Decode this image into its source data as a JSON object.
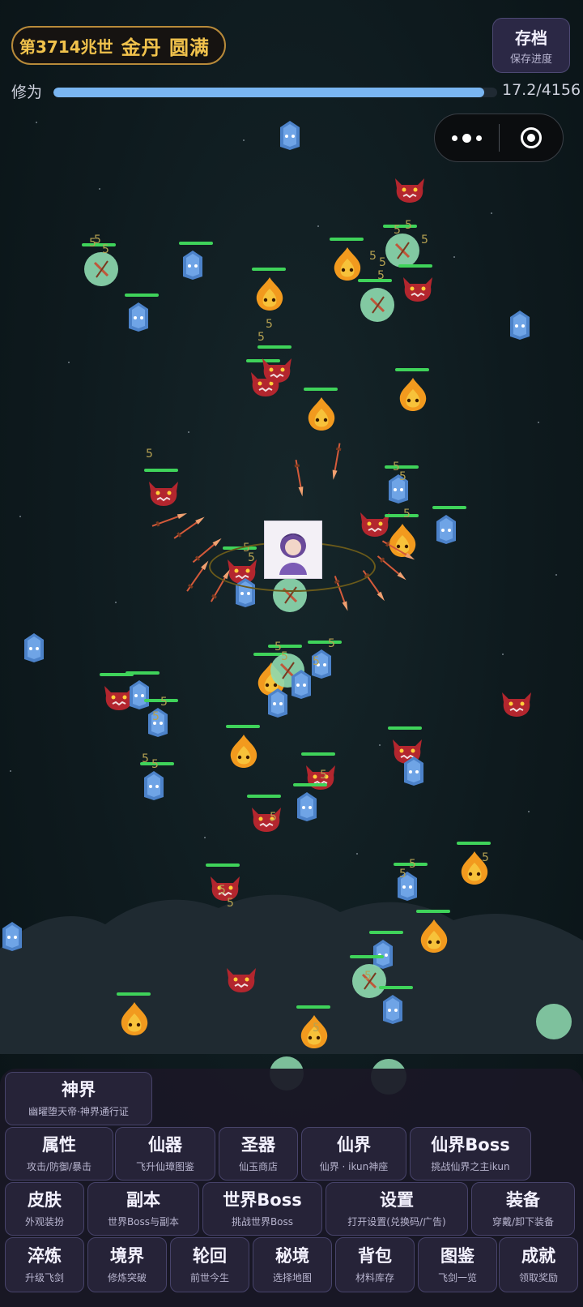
{
  "header": {
    "generation": "第3714兆世",
    "realm": "金丹 圆满"
  },
  "save_button": {
    "title": "存档",
    "subtitle": "保存进度"
  },
  "cultivation": {
    "label": "修为",
    "value_text": "17.2/4156",
    "progress_fraction": 0.97
  },
  "damage_number": "5",
  "menu": {
    "row1": [
      {
        "title": "神界",
        "sub": "幽曜堕天帝·神界通行证"
      }
    ],
    "row2": [
      {
        "title": "属性",
        "sub": "攻击/防御/暴击"
      },
      {
        "title": "仙器",
        "sub": "飞升仙璋图鉴"
      },
      {
        "title": "圣器",
        "sub": "仙玉商店"
      },
      {
        "title": "仙界",
        "sub": "仙界 · ikun神座"
      },
      {
        "title": "仙界Boss",
        "sub": "挑战仙界之主ikun"
      }
    ],
    "row3": [
      {
        "title": "皮肤",
        "sub": "外观装扮"
      },
      {
        "title": "副本",
        "sub": "世界Boss与副本"
      },
      {
        "title": "世界Boss",
        "sub": "挑战世界Boss"
      },
      {
        "title": "设置",
        "sub": "打开设置(兑换码/广告)"
      },
      {
        "title": "装备",
        "sub": "穿戴/卸下装备"
      }
    ],
    "row4": [
      {
        "title": "淬炼",
        "sub": "升级飞剑"
      },
      {
        "title": "境界",
        "sub": "修炼突破"
      },
      {
        "title": "轮回",
        "sub": "前世今生"
      },
      {
        "title": "秘境",
        "sub": "选择地图"
      },
      {
        "title": "背包",
        "sub": "材料库存"
      },
      {
        "title": "图鉴",
        "sub": "飞剑一览"
      },
      {
        "title": "成就",
        "sub": "领取奖励"
      }
    ]
  },
  "colors": {
    "accent_gold": "#f1c24c",
    "xp_bar": "#7ab6f2",
    "hp_bar": "#3fd35a",
    "fire_spirit": "#f29a1e",
    "demon": "#b3262e",
    "ghost": "#4c82c9",
    "slime": "#8fdcb0"
  },
  "icons": [
    "more-dots-icon",
    "record-icon",
    "fire-spirit-icon",
    "red-demon-icon",
    "blue-ghost-icon",
    "green-slime-icon",
    "flying-sword-icon"
  ]
}
